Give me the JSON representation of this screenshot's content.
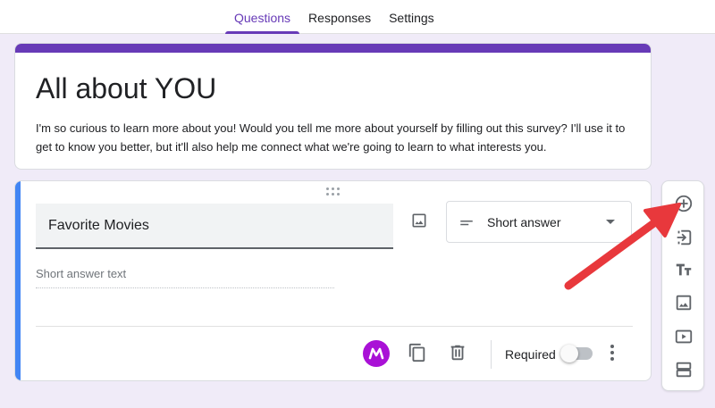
{
  "tabs": [
    {
      "label": "Questions",
      "active": true
    },
    {
      "label": "Responses",
      "active": false
    },
    {
      "label": "Settings",
      "active": false
    }
  ],
  "form": {
    "title": "All about YOU",
    "description": "I'm so curious to learn more about you! Would you tell me more about yourself by filling out this survey? I'll use it to get to know you better, but it'll also help me connect what we're going to learn to what interests you."
  },
  "question": {
    "title": "Favorite Movies",
    "type": "Short answer",
    "answer_placeholder": "Short answer text",
    "required_label": "Required",
    "required": false
  },
  "side_toolbar": {
    "items": [
      "add-question-icon",
      "import-questions-icon",
      "add-title-icon",
      "add-image-icon",
      "add-video-icon",
      "add-section-icon"
    ]
  },
  "colors": {
    "accent": "#673ab7",
    "question_accent": "#4285f4",
    "background": "#f0ebf8",
    "annotation_arrow": "#e8383c",
    "addon": "#a911d6"
  }
}
